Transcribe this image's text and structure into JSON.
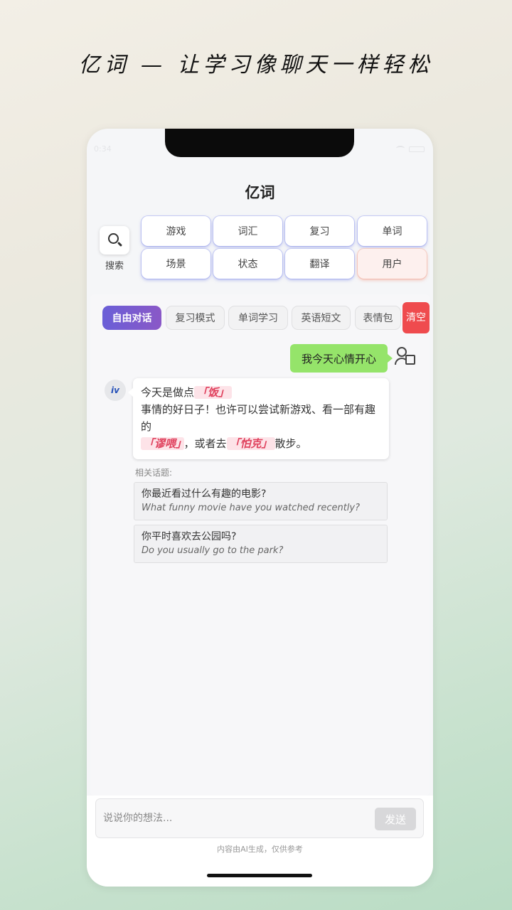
{
  "promo_title": "亿词 — 让学习像聊天一样轻松",
  "status_bar": {
    "time": "0:34"
  },
  "app": {
    "title": "亿词"
  },
  "search": {
    "label": "搜索"
  },
  "categories": [
    "游戏",
    "词汇",
    "复习",
    "单词",
    "场景",
    "状态",
    "翻译",
    "用户"
  ],
  "chat_tabs": [
    "自由对话",
    "复习模式",
    "单词学习",
    "英语短文",
    "表情包"
  ],
  "clear_button": "清空",
  "messages": {
    "user": "我今天心情开心",
    "bot_avatar": "iv",
    "bot": {
      "t1": "今天是做点",
      "k1": "「饭」",
      "t2": "事情的好日子！也许可以尝试新游戏、看一部有趣的",
      "k2": "「谬喂」",
      "t3": "，或者去",
      "k3": "「怕克」",
      "t4": "散步。"
    }
  },
  "related": {
    "label": "相关话题:",
    "topics": [
      {
        "zh": "你最近看过什么有趣的电影?",
        "en": "What funny movie have you watched recently?"
      },
      {
        "zh": "你平时喜欢去公园吗?",
        "en": "Do you usually go to the park?"
      }
    ]
  },
  "input": {
    "placeholder": "说说你的想法...",
    "send_label": "发送"
  },
  "disclaimer": "内容由AI生成，仅供参考",
  "colors": {
    "accent": "#6a5fd7",
    "user_bubble": "#95e46a",
    "clear": "#ef4b4e",
    "keyword": "#e0425e"
  }
}
